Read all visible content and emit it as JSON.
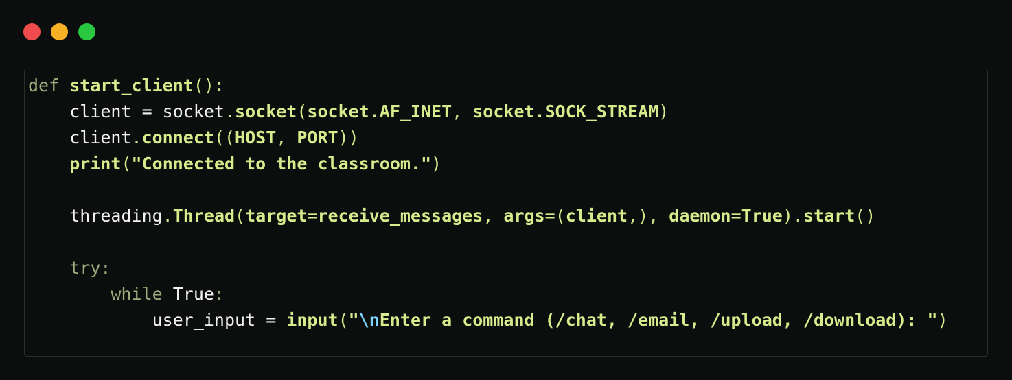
{
  "window_controls": {
    "close_color": "#ef4b4c",
    "minimize_color": "#f7b125",
    "maximize_color": "#2ac840"
  },
  "code": {
    "language": "python",
    "lines": [
      [
        {
          "t": "def",
          "c": "kw"
        },
        {
          "t": " ",
          "c": "plain"
        },
        {
          "t": "start_client",
          "c": "fn"
        },
        {
          "t": "():",
          "c": "punct"
        }
      ],
      [
        {
          "t": "    client",
          "c": "plain"
        },
        {
          "t": " = ",
          "c": "plain"
        },
        {
          "t": "socket",
          "c": "plain"
        },
        {
          "t": ".",
          "c": "punct"
        },
        {
          "t": "socket",
          "c": "bold"
        },
        {
          "t": "(",
          "c": "punct"
        },
        {
          "t": "socket.AF_INET",
          "c": "bold"
        },
        {
          "t": ", ",
          "c": "punct"
        },
        {
          "t": "socket.SOCK_STREAM",
          "c": "bold"
        },
        {
          "t": ")",
          "c": "punct"
        }
      ],
      [
        {
          "t": "    client",
          "c": "plain"
        },
        {
          "t": ".",
          "c": "punct"
        },
        {
          "t": "connect",
          "c": "bold"
        },
        {
          "t": "((",
          "c": "punct"
        },
        {
          "t": "HOST",
          "c": "bold"
        },
        {
          "t": ", ",
          "c": "punct"
        },
        {
          "t": "PORT",
          "c": "bold"
        },
        {
          "t": "))",
          "c": "punct"
        }
      ],
      [
        {
          "t": "    ",
          "c": "plain"
        },
        {
          "t": "print",
          "c": "bold"
        },
        {
          "t": "(",
          "c": "punct"
        },
        {
          "t": "\"Connected to the classroom.\"",
          "c": "str"
        },
        {
          "t": ")",
          "c": "punct"
        }
      ],
      [],
      [
        {
          "t": "    threading",
          "c": "plain"
        },
        {
          "t": ".",
          "c": "punct"
        },
        {
          "t": "Thread",
          "c": "bold"
        },
        {
          "t": "(",
          "c": "punct"
        },
        {
          "t": "target",
          "c": "bold"
        },
        {
          "t": "=",
          "c": "punct"
        },
        {
          "t": "receive_messages",
          "c": "bold"
        },
        {
          "t": ", ",
          "c": "punct"
        },
        {
          "t": "args",
          "c": "bold"
        },
        {
          "t": "=(",
          "c": "punct"
        },
        {
          "t": "client",
          "c": "bold"
        },
        {
          "t": ",), ",
          "c": "punct"
        },
        {
          "t": "daemon",
          "c": "bold"
        },
        {
          "t": "=",
          "c": "punct"
        },
        {
          "t": "True",
          "c": "bold"
        },
        {
          "t": ").",
          "c": "punct"
        },
        {
          "t": "start",
          "c": "bold"
        },
        {
          "t": "()",
          "c": "punct"
        }
      ],
      [],
      [
        {
          "t": "    ",
          "c": "plain"
        },
        {
          "t": "try",
          "c": "kw"
        },
        {
          "t": ":",
          "c": "kw"
        }
      ],
      [
        {
          "t": "        ",
          "c": "plain"
        },
        {
          "t": "while",
          "c": "kw"
        },
        {
          "t": " ",
          "c": "plain"
        },
        {
          "t": "True",
          "c": "plain"
        },
        {
          "t": ":",
          "c": "kw"
        }
      ],
      [
        {
          "t": "            user_input",
          "c": "plain"
        },
        {
          "t": " = ",
          "c": "plain"
        },
        {
          "t": "input",
          "c": "bold"
        },
        {
          "t": "(",
          "c": "punct"
        },
        {
          "t": "\"",
          "c": "str"
        },
        {
          "t": "\\n",
          "c": "esc"
        },
        {
          "t": "Enter a command (/chat, /email, /upload, /download): \"",
          "c": "str"
        },
        {
          "t": ")",
          "c": "punct"
        }
      ]
    ]
  }
}
